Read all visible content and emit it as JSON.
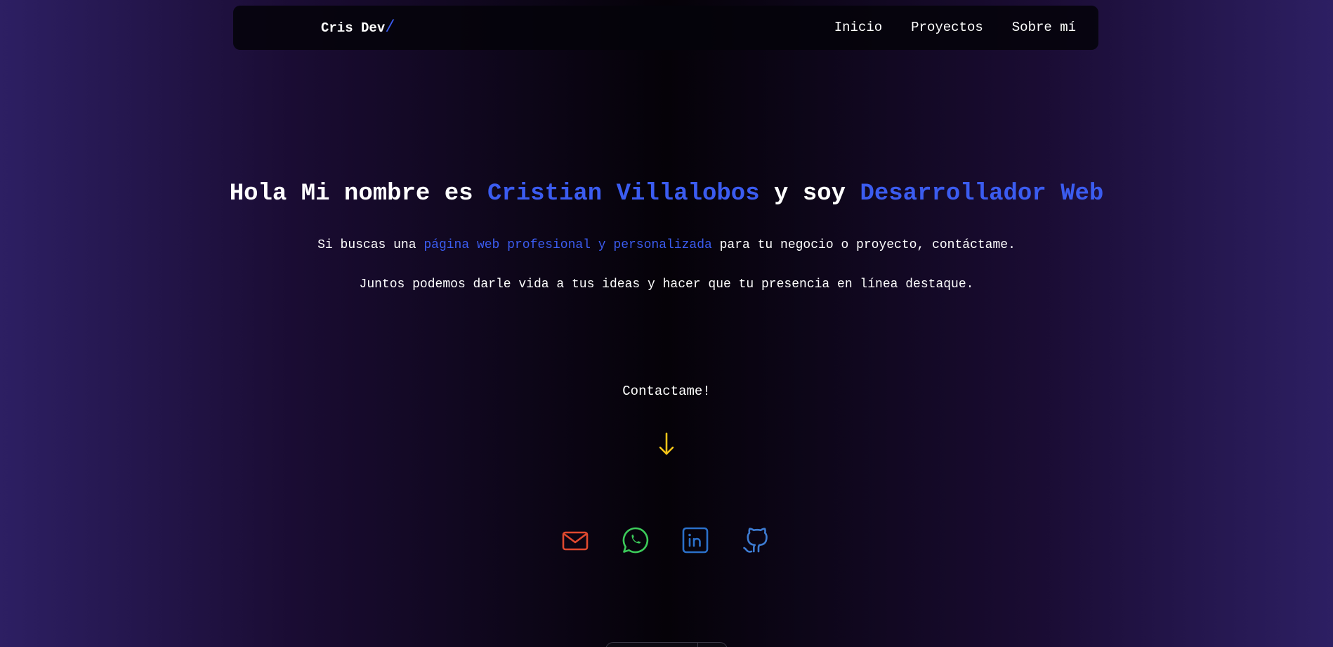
{
  "nav": {
    "logo_text": "Cris Dev",
    "logo_accent": "/",
    "links": [
      "Inicio",
      "Proyectos",
      "Sobre mí"
    ]
  },
  "hero": {
    "title_part1": "Hola Mi nombre es ",
    "title_name": "Cristian Villalobos",
    "title_part2": " y soy ",
    "title_role": "Desarrollador Web",
    "line1_start": "Si buscas una ",
    "line1_highlight": "página web profesional y personalizada",
    "line1_end": " para tu negocio o proyecto, contáctame.",
    "line2": "Juntos podemos darle vida a tus ideas y hacer que tu presencia en línea destaque."
  },
  "contact": {
    "label": "Contactame!",
    "arrow_icon": "arrow-down-icon"
  },
  "social": [
    {
      "icon": "mail-icon",
      "color": "#e0492f"
    },
    {
      "icon": "whatsapp-icon",
      "color": "#3ccb5a"
    },
    {
      "icon": "linkedin-icon",
      "color": "#2b70c9"
    },
    {
      "icon": "github-icon",
      "color": "#3d7bd1"
    }
  ],
  "colors": {
    "accent": "#3b5cf0",
    "arrow": "#f5c518"
  }
}
